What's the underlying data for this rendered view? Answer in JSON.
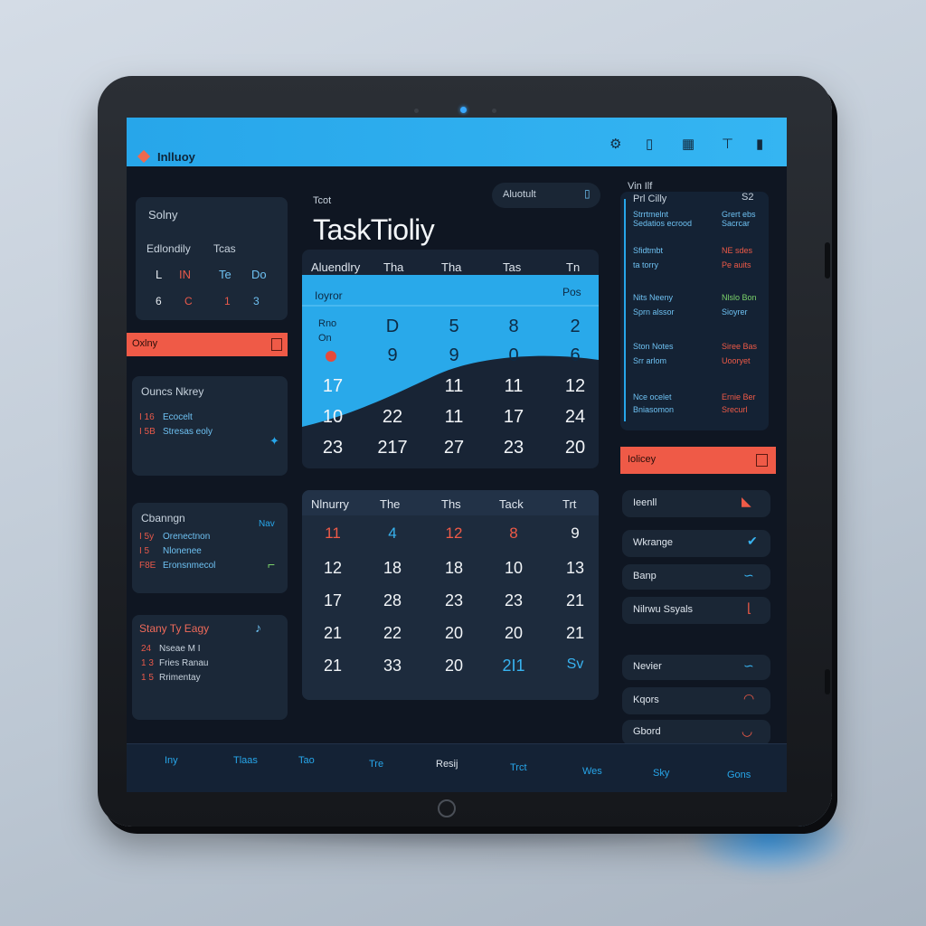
{
  "colors": {
    "accent_blue": "#27a6ea",
    "accent_red": "#ef5a47",
    "panel": "#1b2838",
    "screen_bg": "#0f1622"
  },
  "topbar": {
    "app_name": "Inlluoy",
    "icons": [
      "settings-icon",
      "clipboard-icon",
      "calendar-icon",
      "pin-icon",
      "chart-icon"
    ]
  },
  "left": {
    "card1": {
      "title": "Solny",
      "subtitle": "Edlondily",
      "subtitle2": "Tcas",
      "days": [
        "L",
        "IN",
        "Te",
        "Do"
      ],
      "vals": [
        "6",
        "C",
        "1",
        "3"
      ]
    },
    "alert_bar": {
      "label": "Oxlny"
    },
    "card2": {
      "title": "Ouncs Nkrey",
      "rows": [
        {
          "a": "I 16",
          "b": "Ecocelt"
        },
        {
          "a": "I 5B",
          "b": "Stresas eoly"
        }
      ]
    },
    "card3": {
      "title": "Cbanngn",
      "side": "Nav",
      "rows": [
        {
          "a": "I 5y",
          "b": "Orenectnon"
        },
        {
          "a": "I 5",
          "b": "Nlonenee"
        },
        {
          "a": "F8E",
          "b": "Eronsnmecol"
        }
      ]
    },
    "card4": {
      "title": "Stany Ty Eagy",
      "rows": [
        {
          "a": "24",
          "b": "Nseae M I"
        },
        {
          "a": "1 3",
          "b": "Fries Ranau"
        },
        {
          "a": "1 5",
          "b": "Rrimentay"
        }
      ]
    }
  },
  "center": {
    "small_label": "Tcot",
    "title": "TaskTioliy",
    "search_label": "Aluotult",
    "cal1": {
      "headers": [
        "Aluendlry",
        "Tha",
        "Tha",
        "Tas",
        "Tn"
      ],
      "band_left": "Ioyror",
      "band_right": "Pos",
      "row_labels": [
        "Rno",
        "On"
      ],
      "rows": [
        [
          "",
          "D",
          "5",
          "8",
          "2"
        ],
        [
          "",
          "9",
          "9",
          "0",
          "6"
        ],
        [
          "17",
          "",
          "11",
          "11",
          "12"
        ],
        [
          "10",
          "22",
          "11",
          "17",
          "24"
        ],
        [
          "23",
          "217",
          "27",
          "23",
          "20"
        ]
      ]
    },
    "cal2": {
      "headers": [
        "Nlnurry",
        "The",
        "Ths",
        "Tack",
        "Trt"
      ],
      "rows": [
        [
          "11",
          "4",
          "12",
          "8",
          "9"
        ],
        [
          "12",
          "18",
          "18",
          "10",
          "13"
        ],
        [
          "17",
          "28",
          "23",
          "23",
          "21"
        ],
        [
          "21",
          "22",
          "20",
          "20",
          "21"
        ],
        [
          "21",
          "33",
          "20",
          "2I1",
          "Sv"
        ]
      ]
    }
  },
  "right": {
    "list_title": "Vin Ilf",
    "list_sub": "Prl Cilly",
    "list_sub2": "S2",
    "blocks": [
      {
        "l1": "Strrtmelnt",
        "l2": "Sedatios ecrood",
        "r1": "Grert ebs",
        "r2": "Sacrcar"
      },
      {
        "l1": "Sfidtmbt",
        "l2": "ta torry",
        "r1": "NE sdes",
        "r2": "Pe auits"
      },
      {
        "l1": "Nits Neeny",
        "l2": "Sprn alssor",
        "r1": "Nlslo Bon",
        "r2": "Sioyrer"
      },
      {
        "l1": "Ston Notes",
        "l2": "Srr arlom",
        "r1": "Siree Bas",
        "r2": "Uooryet"
      },
      {
        "l1": "Nce ocelet",
        "l2": "Bniasomon",
        "r1": "Ernie Ber",
        "r2": "Srecurl"
      }
    ],
    "alert_bar": {
      "label": "Iolicey"
    },
    "pills": [
      "Ieenll",
      "Wkrange",
      "Banp",
      "Nilrwu Ssyals",
      "Nevier",
      "Kqors",
      "Gbord"
    ]
  },
  "bottom_nav": [
    "Iny",
    "Tlaas",
    "Tao",
    "Tre",
    "Resij",
    "Trct",
    "Wes",
    "Sky",
    "Gons"
  ]
}
